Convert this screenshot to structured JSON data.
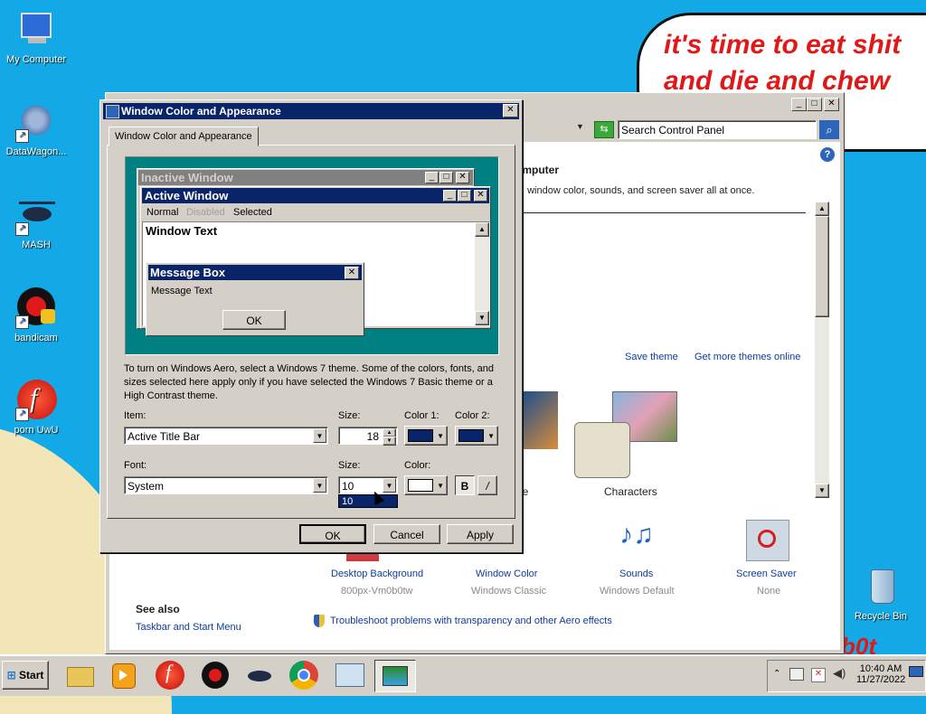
{
  "desktop": {
    "speech_line1": "it's time to eat shit",
    "speech_line2": "and die and chew",
    "scribble": "b0t",
    "icons": [
      {
        "label": "My Computer"
      },
      {
        "label": "DataWagon..."
      },
      {
        "label": "MASH"
      },
      {
        "label": "bandicam"
      },
      {
        "label": "porn UwU"
      },
      {
        "label": "Recycle Bin"
      }
    ]
  },
  "taskbar": {
    "start_label": "Start",
    "clock_time": "10:40 AM",
    "clock_date": "11/27/2022"
  },
  "control_panel": {
    "search_placeholder": "Search Control Panel",
    "heading_fragment": "omputer",
    "desc_fragment": ", window color, sounds, and screen saver all at once.",
    "save_theme": "Save theme",
    "get_more_themes": "Get more themes online",
    "theme_label_partial": "ure",
    "theme_characters": "Characters",
    "bottom_items": [
      {
        "title": "Desktop Background",
        "sub": "800px-Vm0b0tw"
      },
      {
        "title": "Window Color",
        "sub": "Windows Classic"
      },
      {
        "title": "Sounds",
        "sub": "Windows Default"
      },
      {
        "title": "Screen Saver",
        "sub": "None"
      }
    ],
    "see_also": "See also",
    "taskbar_link": "Taskbar and Start Menu",
    "troubleshoot": "Troubleshoot problems with transparency and other Aero effects"
  },
  "dialog": {
    "title": "Window Color and Appearance",
    "tab": "Window Color and Appearance",
    "preview": {
      "inactive": "Inactive Window",
      "active": "Active Window",
      "menu_normal": "Normal",
      "menu_disabled": "Disabled",
      "menu_selected": "Selected",
      "window_text": "Window Text",
      "msgbox_title": "Message Box",
      "msgbox_text": "Message Text",
      "msgbox_ok": "OK"
    },
    "info": "To turn on Windows Aero, select a Windows 7 theme.  Some of the colors, fonts, and sizes selected here apply only if you have selected the Windows 7 Basic theme or a High Contrast theme.",
    "item_label": "Item:",
    "item_value": "Active Title Bar",
    "size_label": "Size:",
    "size_value": "18",
    "color1_label": "Color 1:",
    "color2_label": "Color 2:",
    "font_label": "Font:",
    "font_value": "System",
    "font_size_label": "Size:",
    "font_size_value": "10",
    "font_size_option": "10",
    "color_label": "Color:",
    "bold": "B",
    "italic": "/",
    "ok": "OK",
    "cancel": "Cancel",
    "apply": "Apply"
  },
  "colors": {
    "title_active": "#0a246a",
    "title_inactive": "#808080",
    "desktop": "#12a9e6",
    "preview_bg": "#008080"
  }
}
